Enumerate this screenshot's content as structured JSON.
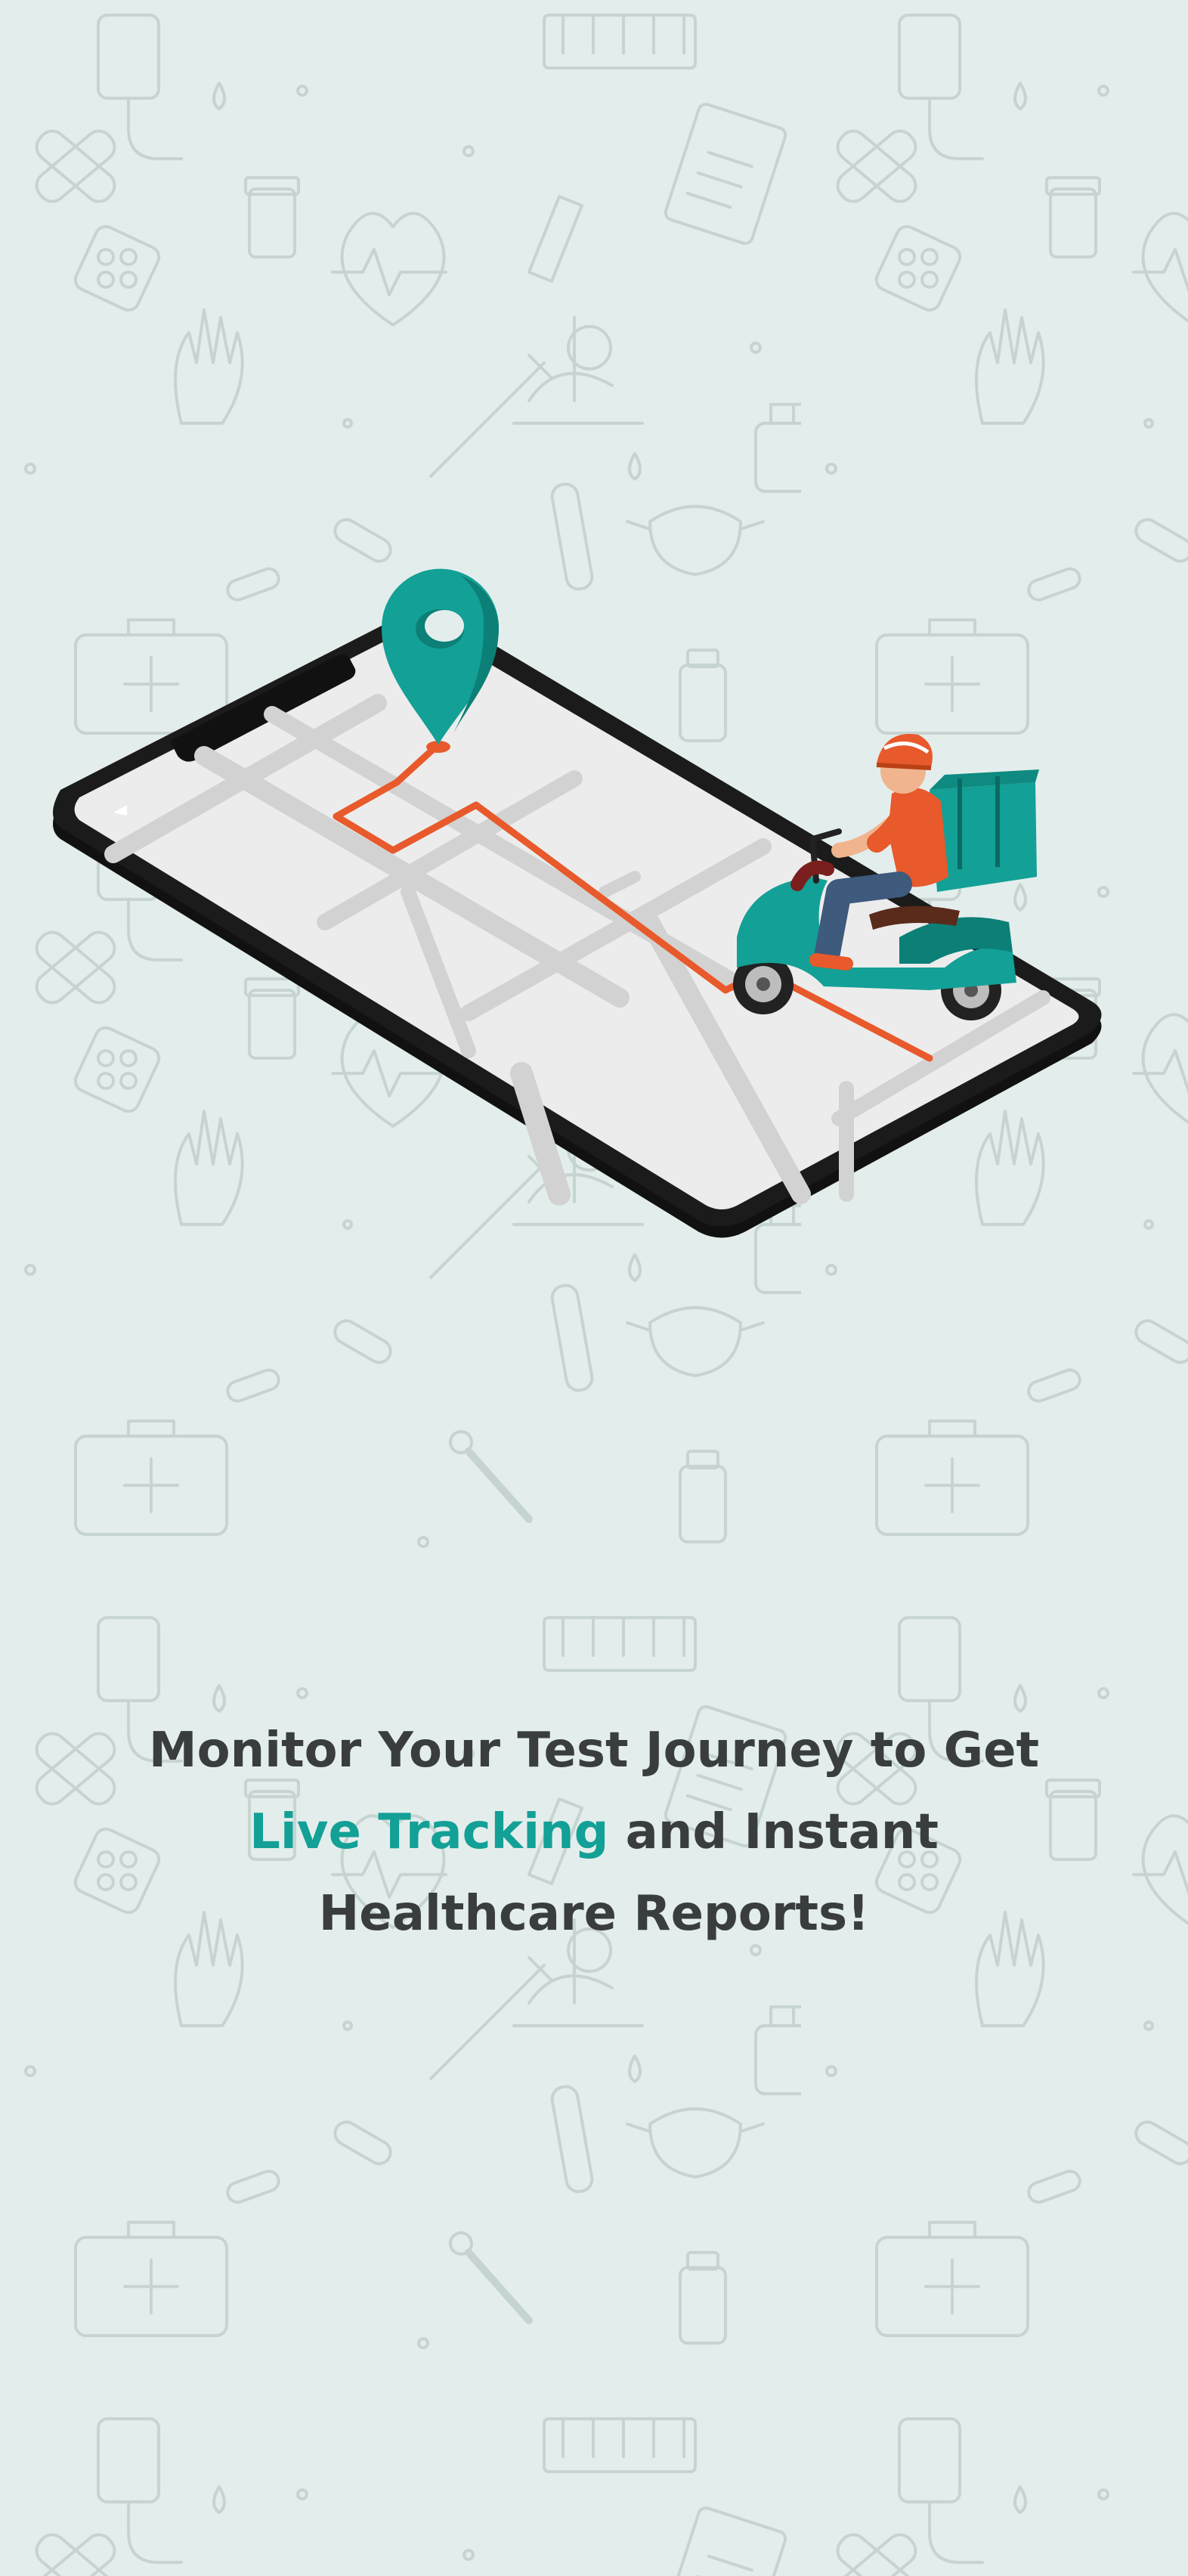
{
  "colors": {
    "background": "#e3eeec",
    "pattern_stroke": "#c8d6d3",
    "accent": "#13a096",
    "text": "#3a3d3e",
    "route": "#e8592b",
    "phone_frame": "#111111",
    "map_surface": "#ececec",
    "map_roads": "#d3d3d3"
  },
  "pattern": {
    "icons": [
      "iv-bag-icon",
      "test-tube-icon",
      "pill-bottle-icon",
      "clipboard-icon",
      "heartbeat-icon",
      "microscope-icon",
      "glove-icon",
      "bandage-icon",
      "pill-blister-icon",
      "syringe-icon",
      "face-mask-icon",
      "first-aid-kit-icon",
      "thermometer-icon",
      "sanitizer-bottle-icon",
      "test-tube-rack-icon",
      "capsule-icon"
    ]
  },
  "illustration": {
    "icons": [
      "smartphone-map-icon",
      "location-pin-icon",
      "delivery-scooter-icon"
    ]
  },
  "headline": {
    "line1": "Monitor Your Test Journey to Get",
    "line2_accent": "Live Tracking",
    "line2_rest": " and Instant",
    "line3": "Healthcare Reports!"
  }
}
